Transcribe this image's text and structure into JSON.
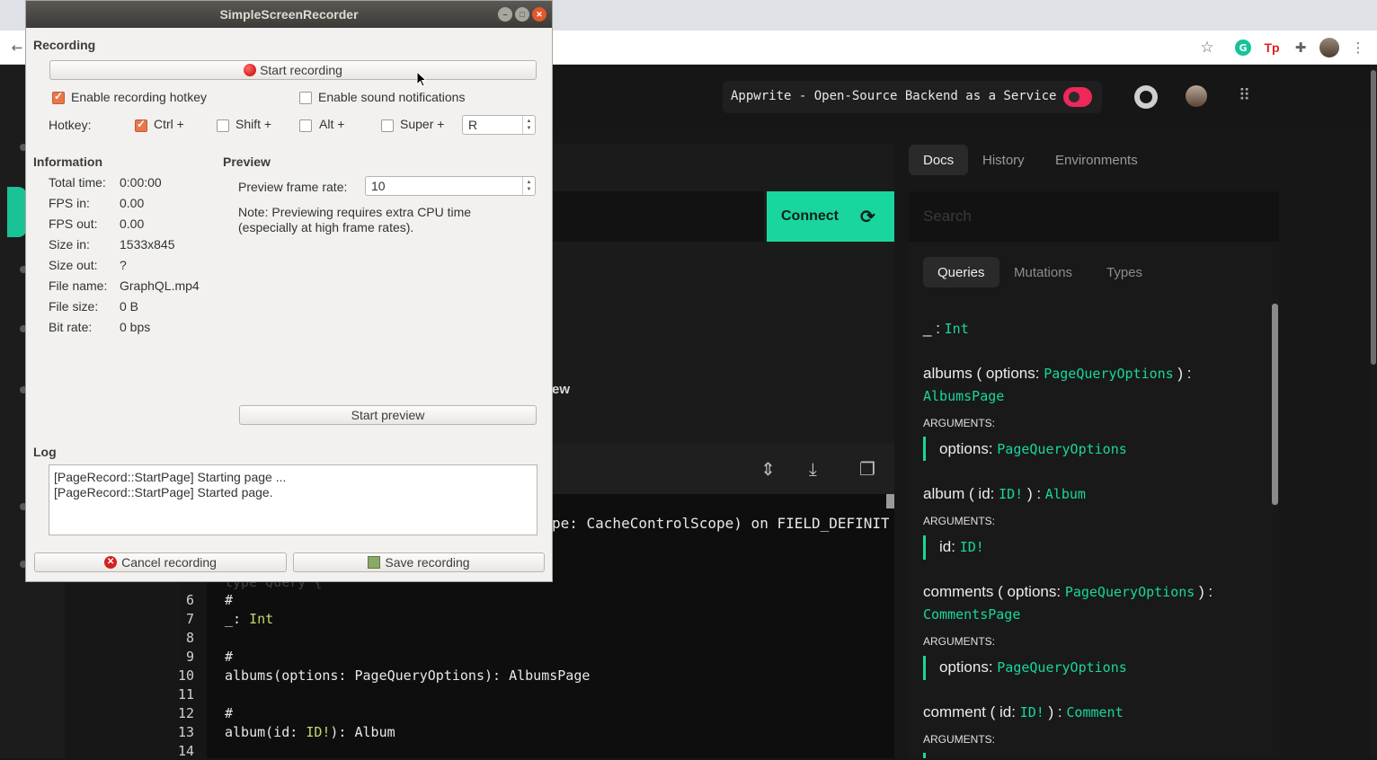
{
  "browser": {
    "extensions": [
      "grammarly-icon",
      "tp-icon",
      "puzzle-icon"
    ],
    "tp_label": "Tp",
    "grammarly_label": "G"
  },
  "app": {
    "header": {
      "badge_text": "Appwrite - Open-Source Backend as a Service"
    },
    "connect_label": "Connect",
    "preview_fragment": "ew",
    "code": {
      "directive_fragment": "pe: CacheControlScope) on FIELD_DEFINIT",
      "hidden_line": "type Query {",
      "lines": [
        {
          "n": "6",
          "text": "#"
        },
        {
          "n": "7",
          "text": "_: Int"
        },
        {
          "n": "8",
          "text": ""
        },
        {
          "n": "9",
          "text": "#"
        },
        {
          "n": "10",
          "text": "albums(options: PageQueryOptions): AlbumsPage"
        },
        {
          "n": "11",
          "text": ""
        },
        {
          "n": "12",
          "text": "#"
        },
        {
          "n": "13",
          "text": "album(id: ID!): Album"
        },
        {
          "n": "14",
          "text": ""
        }
      ]
    },
    "docs": {
      "tabs": [
        "Docs",
        "History",
        "Environments"
      ],
      "search_placeholder": "Search",
      "subtabs": [
        "Queries",
        "Mutations",
        "Types"
      ],
      "entries": {
        "underscore": {
          "name": "_",
          "type": "Int"
        },
        "albums": {
          "name": "albums",
          "arg_label": "options:",
          "arg_type": "PageQueryOptions",
          "return": "AlbumsPage"
        },
        "album": {
          "name": "album",
          "arg_label": "id:",
          "arg_type": "ID!",
          "return": "Album"
        },
        "comments": {
          "name": "comments",
          "arg_label": "options:",
          "arg_type": "PageQueryOptions",
          "return": "CommentsPage"
        },
        "comment": {
          "name": "comment",
          "arg_label": "id:",
          "arg_type": "ID!",
          "return": "Comment"
        }
      },
      "arguments_label": "ARGUMENTS:"
    }
  },
  "recorder": {
    "title": "SimpleScreenRecorder",
    "recording_heading": "Recording",
    "start_recording": "Start recording",
    "enable_hotkey": "Enable recording hotkey",
    "enable_sound": "Enable sound notifications",
    "hotkey_label": "Hotkey:",
    "ctrl": "Ctrl +",
    "shift": "Shift +",
    "alt": "Alt +",
    "super": "Super +",
    "hotkey_key": "R",
    "information_heading": "Information",
    "info": [
      {
        "label": "Total time:",
        "value": "0:00:00"
      },
      {
        "label": "FPS in:",
        "value": "0.00"
      },
      {
        "label": "FPS out:",
        "value": "0.00"
      },
      {
        "label": "Size in:",
        "value": "1533x845"
      },
      {
        "label": "Size out:",
        "value": "?"
      },
      {
        "label": "File name:",
        "value": "GraphQL.mp4"
      },
      {
        "label": "File size:",
        "value": "0 B"
      },
      {
        "label": "Bit rate:",
        "value": "0 bps"
      }
    ],
    "preview_heading": "Preview",
    "preview_rate_label": "Preview frame rate:",
    "preview_rate": "10",
    "note_line1": "Note: Previewing requires extra CPU time",
    "note_line2": "(especially at high frame rates).",
    "start_preview": "Start preview",
    "log_heading": "Log",
    "log": [
      "[PageRecord::StartPage] Starting page ...",
      "[PageRecord::StartPage] Started page."
    ],
    "cancel_recording": "Cancel recording",
    "save_recording": "Save recording"
  }
}
